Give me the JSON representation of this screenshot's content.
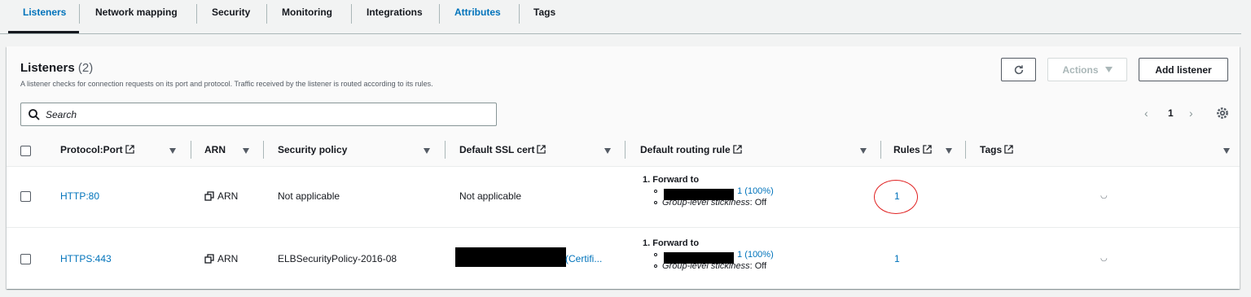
{
  "tabs": [
    {
      "label": "Listeners",
      "active": true
    },
    {
      "label": "Network mapping"
    },
    {
      "label": "Security"
    },
    {
      "label": "Monitoring"
    },
    {
      "label": "Integrations"
    },
    {
      "label": "Attributes"
    },
    {
      "label": "Tags"
    }
  ],
  "panel": {
    "title": "Listeners",
    "count": "(2)",
    "description": "A listener checks for connection requests on its port and protocol. Traffic received by the listener is routed according to its rules.",
    "actions_label": "Actions",
    "add_label": "Add listener",
    "search_placeholder": "Search",
    "page": "1"
  },
  "columns": {
    "protocol_port": "Protocol:Port",
    "arn": "ARN",
    "security_policy": "Security policy",
    "default_ssl_cert": "Default SSL cert",
    "default_routing_rule": "Default routing rule",
    "rules": "Rules",
    "tags": "Tags"
  },
  "rows": [
    {
      "protocol_port": "HTTP:80",
      "arn": "ARN",
      "security_policy": "Not applicable",
      "ssl_cert": "Not applicable",
      "route_title": "1. Forward to",
      "route_target": ": 1 (100%)",
      "stickiness_label": "Group-level stickiness",
      "stickiness_value": ": Off",
      "rules": "1"
    },
    {
      "protocol_port": "HTTPS:443",
      "arn": "ARN",
      "security_policy": "ELBSecurityPolicy-2016-08",
      "ssl_cert": "(Certifi...",
      "route_title": "1. Forward to",
      "route_target": ": 1 (100%)",
      "stickiness_label": "Group-level stickiness",
      "stickiness_value": ": Off",
      "rules": "1"
    }
  ],
  "colors": {
    "link": "#0073bb",
    "annotation": "#e02020"
  }
}
